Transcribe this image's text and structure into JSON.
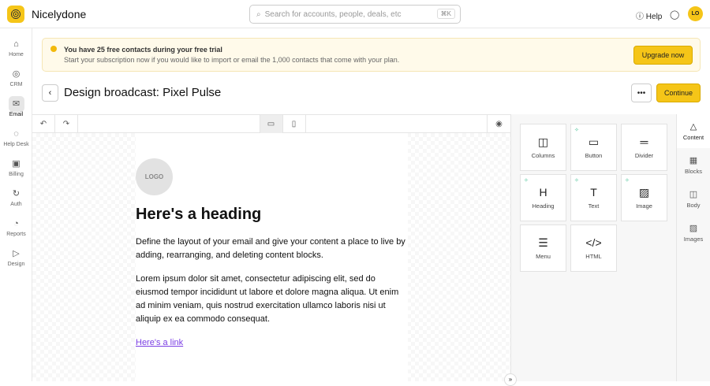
{
  "app": {
    "name": "Nicelydone",
    "search_placeholder": "Search for accounts, people, deals, etc",
    "search_shortcut": "⌘K",
    "help": "Help",
    "avatar": "LO"
  },
  "sidebar": [
    {
      "label": "Home",
      "icon": "⌂"
    },
    {
      "label": "CRM",
      "icon": "◎"
    },
    {
      "label": "Email",
      "icon": "✉"
    },
    {
      "label": "Help Desk",
      "icon": "◌"
    },
    {
      "label": "Billing",
      "icon": "▣"
    },
    {
      "label": "Auth",
      "icon": "↻"
    },
    {
      "label": "Reports",
      "icon": "◔"
    },
    {
      "label": "Design",
      "icon": "▷"
    }
  ],
  "banner": {
    "title": "You have 25 free contacts during your free trial",
    "text": "Start your subscription now if you would like to import or email the 1,000 contacts that come with your plan.",
    "button": "Upgrade now"
  },
  "header": {
    "title": "Design broadcast: Pixel Pulse",
    "more": "•••",
    "continue": "Continue"
  },
  "email": {
    "logo": "LOGO",
    "heading": "Here's a heading",
    "p1": "Define the layout of your email and give your content a place to live by adding, rearranging, and deleting content blocks.",
    "p2": "Lorem ipsum dolor sit amet, consectetur adipiscing elit, sed do eiusmod tempor incididunt ut labore et dolore magna aliqua. Ut enim ad minim veniam, quis nostrud exercitation ullamco laboris nisi ut aliquip ex ea commodo consequat.",
    "link": "Here's a link"
  },
  "blocks": [
    {
      "label": "Columns",
      "icon": "◫",
      "ai": false
    },
    {
      "label": "Button",
      "icon": "▭",
      "ai": true
    },
    {
      "label": "Divider",
      "icon": "═",
      "ai": false
    },
    {
      "label": "Heading",
      "icon": "H",
      "ai": true
    },
    {
      "label": "Text",
      "icon": "T",
      "ai": true
    },
    {
      "label": "Image",
      "icon": "▨",
      "ai": true
    },
    {
      "label": "Menu",
      "icon": "☰",
      "ai": false
    },
    {
      "label": "HTML",
      "icon": "</>",
      "ai": false
    }
  ],
  "tabs": [
    {
      "label": "Content",
      "icon": "△"
    },
    {
      "label": "Blocks",
      "icon": "▦"
    },
    {
      "label": "Body",
      "icon": "◫"
    },
    {
      "label": "Images",
      "icon": "▨"
    }
  ]
}
